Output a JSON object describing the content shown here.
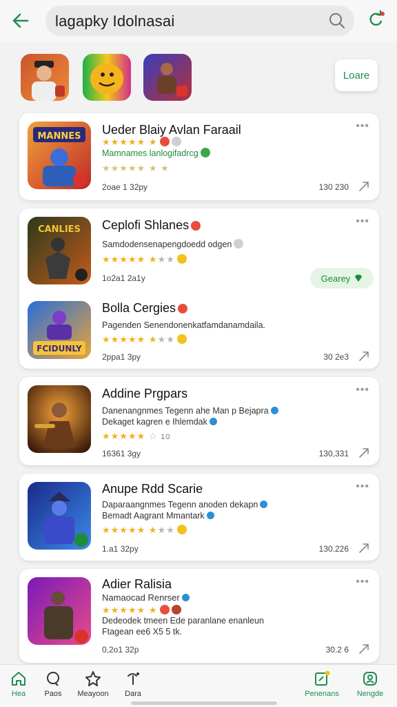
{
  "header": {
    "search_value": "lagapky Idolnasai"
  },
  "featured": {
    "load_label": "Loare"
  },
  "apps": [
    {
      "title": "Ueder Blaiy Avlan Faraail",
      "line1": "Mamnames  lanlogifadrcg",
      "meta_left": "2oae 1 32py",
      "meta_right": "130 230",
      "icon_text": "MANNES"
    },
    {
      "title": "Ceplofi Shlanes",
      "line1": "Samdodensenapengdoedd odgen",
      "meta_left": "1o2a1 2a1y",
      "get_label": "Gearey",
      "icon_text": "CANLIES"
    },
    {
      "title": "Bolla  Cergies",
      "line1": "Pagenden Senendonenkatfamdanamdaila.",
      "meta_left": "2ppa1 3py",
      "meta_right": "30 2e3",
      "icon_text": "FCIDUNLY"
    },
    {
      "title": "Addine Prgpars",
      "line1": "Danenangnmes Tegenn ahe Man p Bejapra",
      "line2": "Dekaget kagren e Ihlemdak",
      "meta_left": "16361 3gy",
      "meta_right": "130,331"
    },
    {
      "title": "Anupe Rdd Scarie",
      "line1": "Daparaangnmes Tegenn anoden dekapn",
      "line2": "Bemadt Aagrant Mmantark",
      "meta_left": "1.a1 32py",
      "meta_right": "130.226"
    },
    {
      "title": "Adier Ralisia",
      "line1": "Namaocad Renrser",
      "line2": "Dedeodek tmeen Ede paranlane enanleun",
      "line3": "Ftagean ee6 X5  5 tk.",
      "meta_left": "0,2o1 32p",
      "meta_right": "30.2 6"
    }
  ],
  "nav": [
    {
      "label": "Hea",
      "icon": "home-icon"
    },
    {
      "label": "Paos",
      "icon": "chat-icon"
    },
    {
      "label": "Meayoon",
      "icon": "star-icon"
    },
    {
      "label": "Dara",
      "icon": "music-icon"
    },
    {
      "label": "Penenans",
      "icon": "edit-icon"
    },
    {
      "label": "Nengde",
      "icon": "profile-icon"
    }
  ],
  "colors": {
    "accent": "#1e8c52",
    "star": "#f2b01e"
  }
}
